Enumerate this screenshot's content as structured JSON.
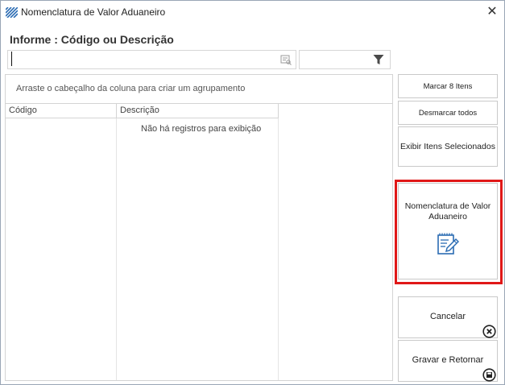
{
  "window": {
    "title": "Nomenclatura de Valor Aduaneiro",
    "close_glyph": "✕"
  },
  "search": {
    "label": "Informe : Código ou Descrição",
    "value": "",
    "placeholder": "",
    "filter_value": ""
  },
  "grid": {
    "group_hint": "Arraste o cabeçalho da coluna para criar um agrupamento",
    "columns": [
      "Código",
      "Descrição"
    ],
    "empty_message": "Não há registros para exibição"
  },
  "buttons": {
    "marcar": "Marcar 8 Itens",
    "desmarcar": "Desmarcar todos",
    "exibir": "Exibir Itens Selecionados",
    "nomenclatura": "Nomenclatura de Valor Aduaneiro",
    "cancelar": "Cancelar",
    "gravar": "Gravar e Retornar"
  },
  "icons": {
    "app": "app-grid-icon",
    "search": "search-lookup-icon",
    "filter": "funnel-filter-icon",
    "nomenclatura": "notepad-edit-icon",
    "cancel": "circle-x-icon",
    "save": "floppy-save-icon"
  },
  "colors": {
    "highlight": "#e01818",
    "accent_blue": "#2b6cb3"
  }
}
